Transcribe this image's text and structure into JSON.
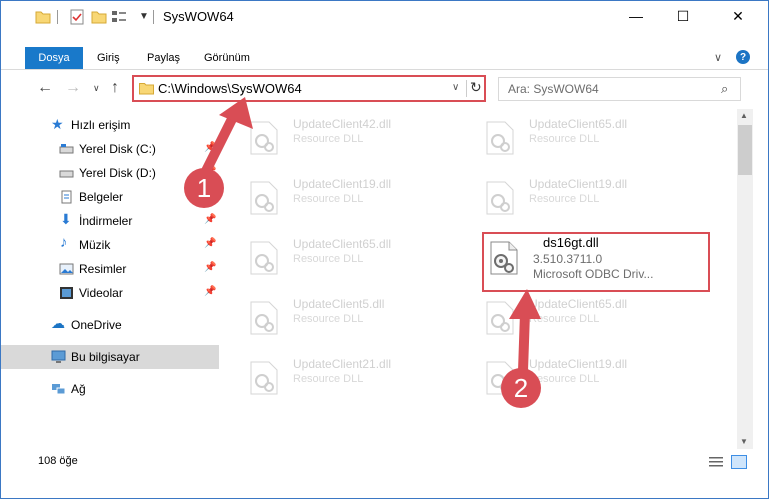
{
  "window": {
    "title": "SysWOW64",
    "minimize_icon": "—",
    "maximize_icon": "☐",
    "close_icon": "✕"
  },
  "ribbon": {
    "file_tab": "Dosya",
    "tabs": [
      "Giriş",
      "Paylaş",
      "Görünüm"
    ],
    "help_label": "?"
  },
  "nav": {
    "address": "C:\\Windows\\SysWOW64",
    "search_placeholder": "Ara: SysWOW64"
  },
  "sidebar": {
    "quick_access": "Hızlı erişim",
    "items": [
      {
        "label": "Yerel Disk (C:)",
        "pinned": true
      },
      {
        "label": "Yerel Disk (D:)",
        "pinned": true
      },
      {
        "label": "Belgeler",
        "pinned": true
      },
      {
        "label": "İndirmeler",
        "pinned": true
      },
      {
        "label": "Müzik",
        "pinned": true
      },
      {
        "label": "Resimler",
        "pinned": true
      },
      {
        "label": "Videolar",
        "pinned": true
      }
    ],
    "onedrive": "OneDrive",
    "this_pc": "Bu bilgisayar",
    "network": "Ağ"
  },
  "files": {
    "left_column": [
      {
        "name": "UpdateClient42.dll",
        "desc": "Resource DLL"
      },
      {
        "name": "UpdateClient19.dll",
        "desc": "Resource DLL"
      },
      {
        "name": "UpdateClient65.dll",
        "desc": "Resource DLL"
      },
      {
        "name": "UpdateClient5.dll",
        "desc": "Resource DLL"
      },
      {
        "name": "UpdateClient21.dll",
        "desc": "Resource DLL"
      }
    ],
    "right_column": [
      {
        "name": "UpdateClient65.dll",
        "desc": "Resource DLL"
      },
      {
        "name": "UpdateClient19.dll",
        "desc": "Resource DLL"
      },
      {
        "name": "UpdateClient65.dll",
        "desc": "Resource DLL"
      },
      {
        "name": "UpdateClient19.dll",
        "desc": "Resource DLL"
      }
    ],
    "highlighted": {
      "name": "ds16gt.dll",
      "version": "3.510.3711.0",
      "desc": "Microsoft ODBC Driv..."
    }
  },
  "status": {
    "item_count": "108 öğe"
  },
  "annotations": {
    "step1": "1",
    "step2": "2",
    "color": "#d94d55"
  },
  "colors": {
    "accent": "#1979ca",
    "selection": "#cce8ff"
  }
}
